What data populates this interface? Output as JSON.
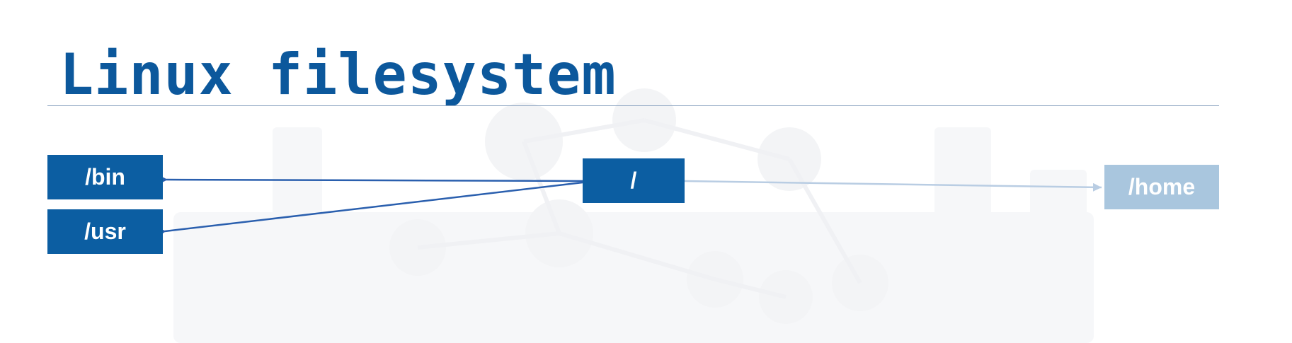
{
  "slide": {
    "title": "Linux filesystem"
  },
  "diagram": {
    "nodes": {
      "bin": "/bin",
      "usr": "/usr",
      "root": "/",
      "home": "/home"
    },
    "colors": {
      "title": "#0c589c",
      "node_fill": "#0c5ea2",
      "node_faded_fill": "#a9c6de",
      "arrow": "#2a5fae",
      "arrow_faded": "#b9cde3",
      "rule": "#8fa6c2"
    }
  }
}
